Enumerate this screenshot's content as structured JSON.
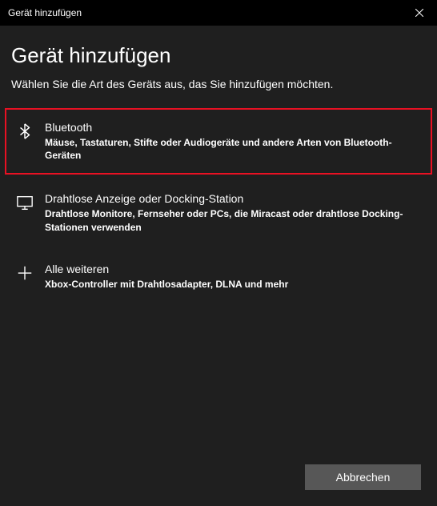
{
  "titlebar": {
    "title": "Gerät hinzufügen"
  },
  "header": {
    "title": "Gerät hinzufügen",
    "subtitle": "Wählen Sie die Art des Geräts aus, das Sie hinzufügen möchten."
  },
  "options": [
    {
      "title": "Bluetooth",
      "description": "Mäuse, Tastaturen, Stifte oder Audiogeräte und andere Arten von Bluetooth-Geräten",
      "highlighted": true
    },
    {
      "title": "Drahtlose Anzeige oder Docking-Station",
      "description": "Drahtlose Monitore, Fernseher oder PCs, die Miracast oder drahtlose Docking-Stationen verwenden",
      "highlighted": false
    },
    {
      "title": "Alle weiteren",
      "description": "Xbox-Controller mit Drahtlosadapter, DLNA und mehr",
      "highlighted": false
    }
  ],
  "footer": {
    "cancel_label": "Abbrechen"
  }
}
